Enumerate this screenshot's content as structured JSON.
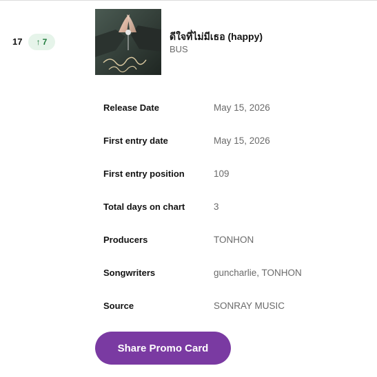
{
  "entry": {
    "rank": "17",
    "change": "7",
    "change_direction": "up",
    "change_icon": "arrow-up-icon",
    "title": "ดีใจที่ไม่มีเธอ (happy)",
    "artist": "BUS",
    "cover_icon": "album-cover-image"
  },
  "details": [
    {
      "label": "Release Date",
      "value": "May 15, 2026"
    },
    {
      "label": "First entry date",
      "value": "May 15, 2026"
    },
    {
      "label": "First entry position",
      "value": "109"
    },
    {
      "label": "Total days on chart",
      "value": "3"
    },
    {
      "label": "Producers",
      "value": "TONHON"
    },
    {
      "label": "Songwriters",
      "value": "guncharlie, TONHON"
    },
    {
      "label": "Source",
      "value": "SONRAY MUSIC"
    }
  ],
  "share_button": {
    "label": "Share Promo Card"
  },
  "colors": {
    "accent": "#7a3aa2",
    "badge_bg": "#e6f4ea",
    "badge_text": "#1d7a3a"
  }
}
